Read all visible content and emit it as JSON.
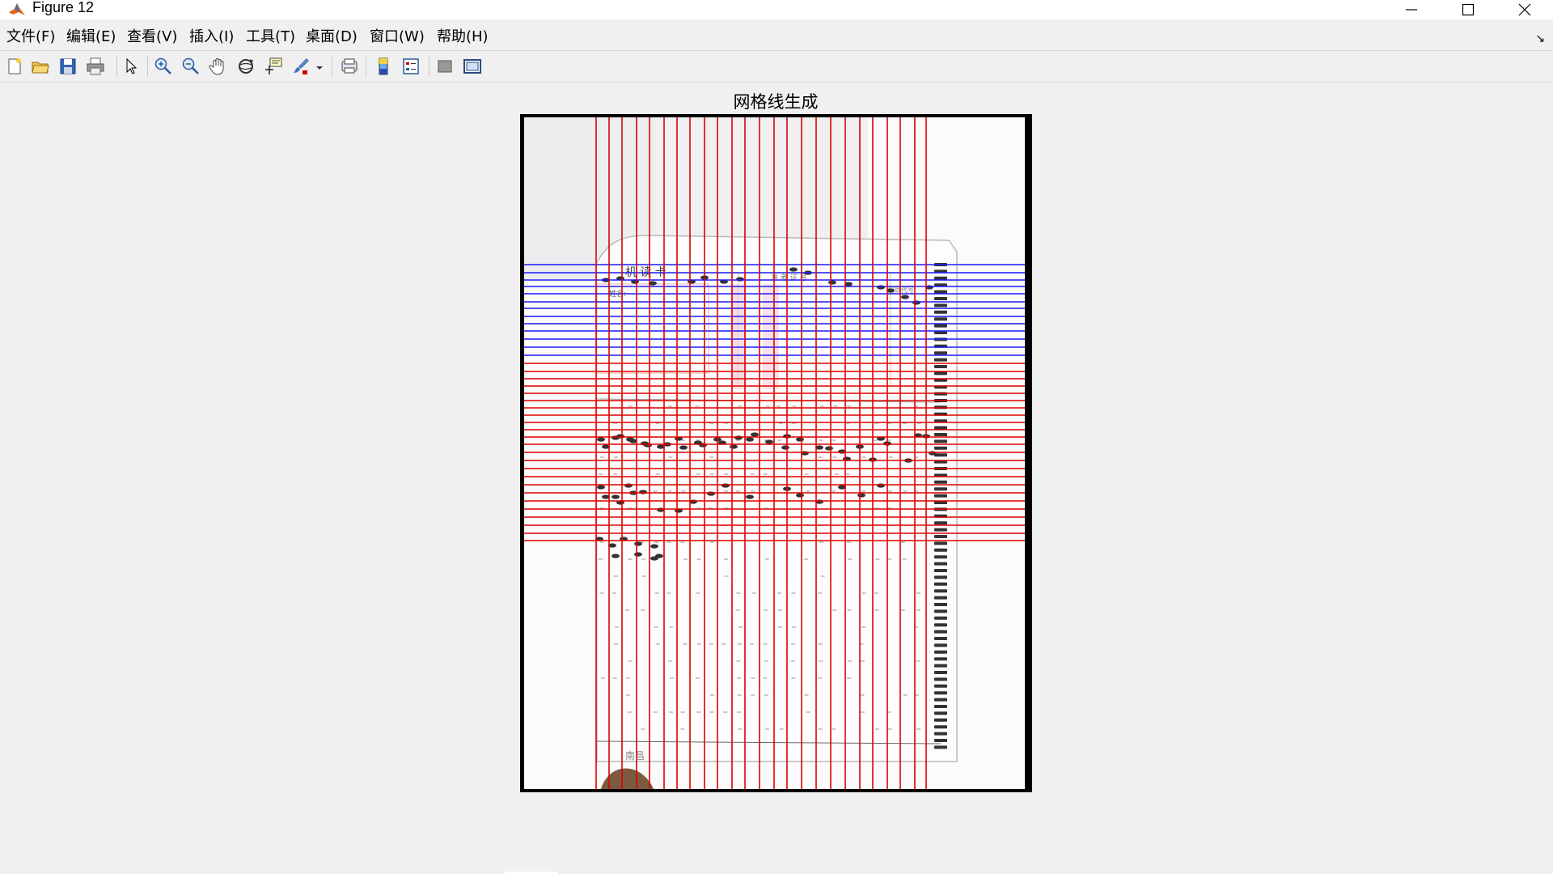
{
  "window": {
    "title": "Figure 12",
    "app_icon": "matlab-icon",
    "controls": [
      "minimize-icon",
      "maximize-icon",
      "close-icon"
    ]
  },
  "menu": {
    "items": [
      {
        "label": "文件(F)"
      },
      {
        "label": "编辑(E)"
      },
      {
        "label": "查看(V)"
      },
      {
        "label": "插入(I)"
      },
      {
        "label": "工具(T)"
      },
      {
        "label": "桌面(D)"
      },
      {
        "label": "窗口(W)"
      },
      {
        "label": "帮助(H)"
      }
    ],
    "dock_arrow": "↘"
  },
  "toolbar": {
    "buttons": [
      "new-figure-icon",
      "open-file-icon",
      "save-icon",
      "print-icon",
      "pointer-icon",
      "zoom-in-icon",
      "zoom-out-icon",
      "pan-hand-icon",
      "rotate-3d-icon",
      "data-cursor-icon",
      "brush-icon",
      "link-plot-icon",
      "colorbar-icon",
      "legend-icon",
      "hide-plot-tools-icon",
      "show-plot-tools-icon"
    ]
  },
  "figure": {
    "title": "网格线生成",
    "image": {
      "card_title": "机 读 卡",
      "name_label": "姓名:",
      "exam_label": "准 考 证 号",
      "subject_label": "科目代号",
      "footer_text": "南昌"
    },
    "grid_colors": {
      "vertical": "#e00000",
      "horizontal_top": "#1a1aff",
      "horizontal_bottom": "#e00000"
    }
  }
}
